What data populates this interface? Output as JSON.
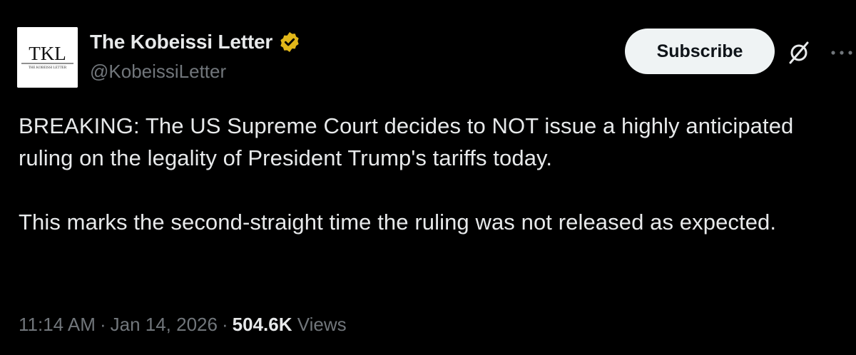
{
  "author": {
    "display_name": "The Kobeissi Letter",
    "handle": "@KobeissiLetter",
    "avatar_text": "TKL",
    "avatar_subtext": "THE KOBEISSI LETTER",
    "verified": true,
    "verified_color": "#e2b719"
  },
  "actions": {
    "subscribe_label": "Subscribe",
    "grok_icon": "grok-icon",
    "more_icon": "more-icon"
  },
  "tweet": {
    "paragraphs": [
      "BREAKING: The US Supreme Court decides to NOT issue a highly anticipated ruling on the legality of President Trump's tariffs today.",
      "This marks the second-straight time the ruling was not released as expected."
    ],
    "time": "11:14 AM",
    "date": "Jan 14, 2026",
    "separator": "·",
    "views_count": "504.6K",
    "views_label": "Views"
  },
  "colors": {
    "background": "#000000",
    "text_primary": "#e7e9ea",
    "text_secondary": "#71767b",
    "button_bg": "#eff3f4"
  }
}
